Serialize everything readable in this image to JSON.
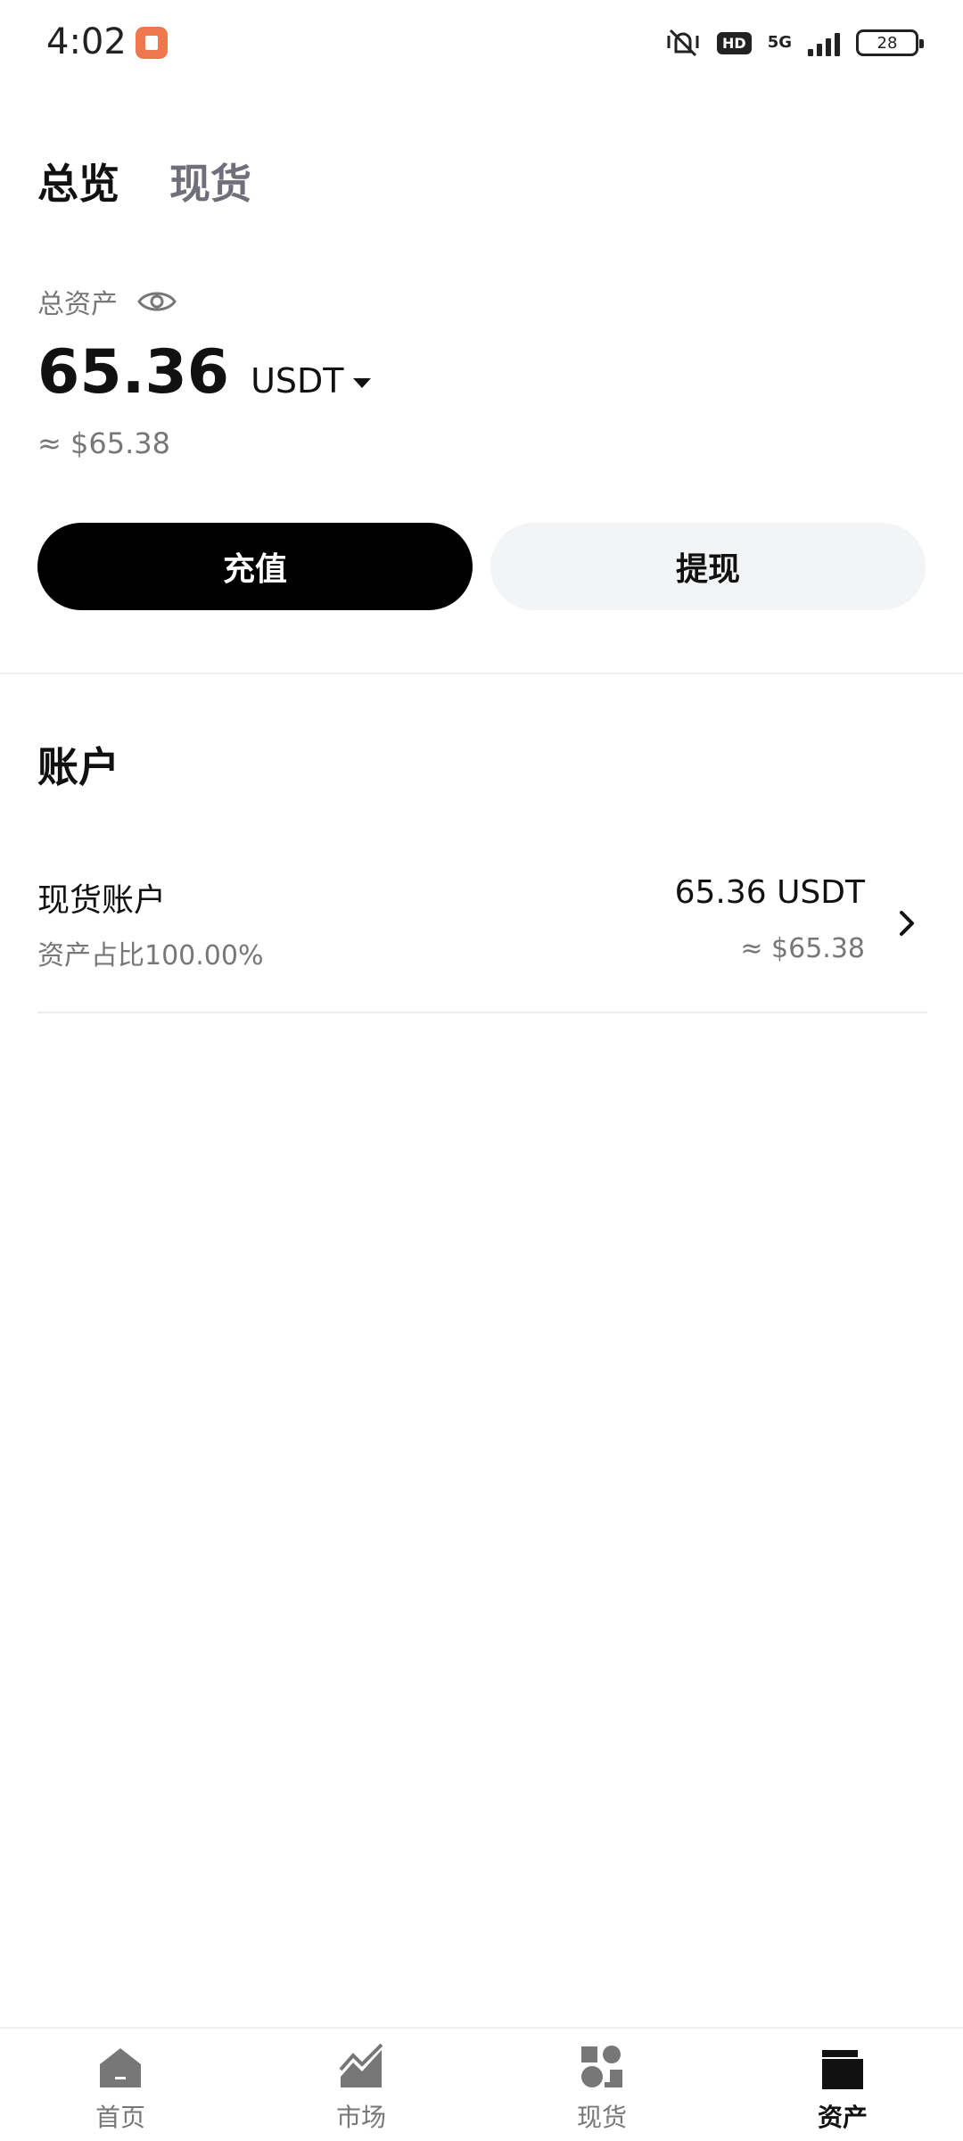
{
  "status_bar": {
    "time": "4:02",
    "network": "5G",
    "hd": "HD",
    "battery": "28"
  },
  "tabs": [
    {
      "label": "总览",
      "active": true
    },
    {
      "label": "现货",
      "active": false
    }
  ],
  "total_assets": {
    "label": "总资产",
    "amount": "65.36",
    "currency": "USDT",
    "approx": "≈ $65.38"
  },
  "actions": {
    "deposit": "充值",
    "withdraw": "提现"
  },
  "accounts": {
    "title": "账户",
    "items": [
      {
        "name": "现货账户",
        "ratio": "资产占比100.00%",
        "amount": "65.36 USDT",
        "approx": "≈ $65.38"
      }
    ]
  },
  "bottom_nav": [
    {
      "label": "首页",
      "icon": "home-icon",
      "active": false
    },
    {
      "label": "市场",
      "icon": "market-chart-icon",
      "active": false
    },
    {
      "label": "现货",
      "icon": "spot-trade-icon",
      "active": false
    },
    {
      "label": "资产",
      "icon": "wallet-icon",
      "active": true
    }
  ],
  "colors": {
    "primary_button": "#000000",
    "secondary_button": "#f3f4f6",
    "muted_text": "#777777",
    "notification_icon": "#f0774d"
  }
}
